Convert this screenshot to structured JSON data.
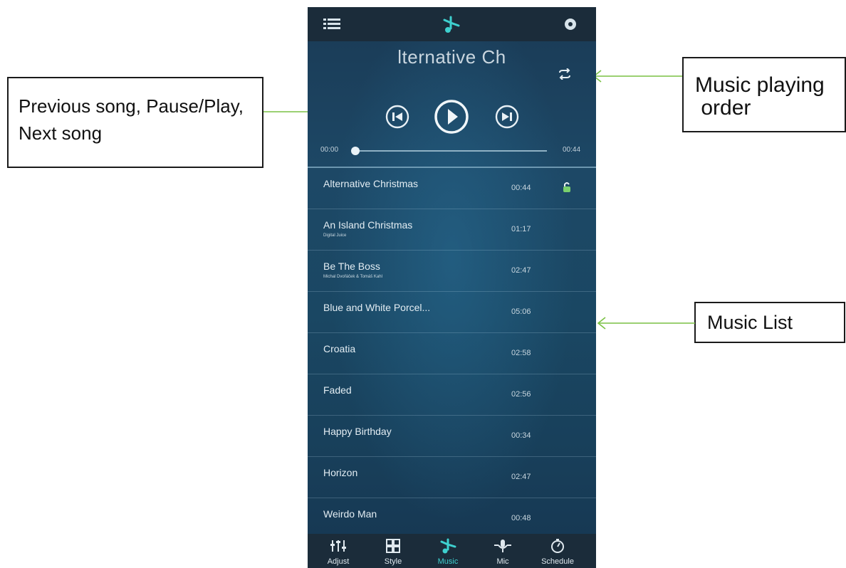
{
  "annotations": {
    "controls_callout": {
      "line1": "Previous song, Pause/Play,",
      "line2": "Next song"
    },
    "order_callout": {
      "line1": "Music playing",
      "line2": " order"
    },
    "list_callout": {
      "label": "Music List"
    }
  },
  "player": {
    "now_playing_title": "lternative Ch",
    "elapsed": "00:00",
    "total": "00:44",
    "progress_fraction": 0.0
  },
  "songs": [
    {
      "title": "Alternative Christmas",
      "artist": "",
      "duration": "00:44",
      "playing": true
    },
    {
      "title": "An Island Christmas",
      "artist": "Digital Juice",
      "duration": "01:17"
    },
    {
      "title": "Be The Boss",
      "artist": "Michal Dvořáček & Tomáš Kahl",
      "duration": "02:47"
    },
    {
      "title": "Blue and White Porcel...",
      "artist": "",
      "duration": "05:06"
    },
    {
      "title": "Croatia",
      "artist": "",
      "duration": "02:58"
    },
    {
      "title": "Faded",
      "artist": "",
      "duration": "02:56"
    },
    {
      "title": "Happy Birthday",
      "artist": "",
      "duration": "00:34"
    },
    {
      "title": "Horizon",
      "artist": "",
      "duration": "02:47"
    },
    {
      "title": "Weirdo Man",
      "artist": "",
      "duration": "00:48"
    }
  ],
  "tabs": [
    {
      "label": "Adjust",
      "icon": "equalizer-icon"
    },
    {
      "label": "Style",
      "icon": "grid-icon"
    },
    {
      "label": "Music",
      "icon": "music-note-icon",
      "active": true
    },
    {
      "label": "Mic",
      "icon": "microphone-icon"
    },
    {
      "label": "Schedule",
      "icon": "timer-icon"
    }
  ],
  "colors": {
    "accent": "#3ed0cf",
    "callout_arrow": "#7ac143",
    "bar_bg": "#1b2c3a"
  }
}
